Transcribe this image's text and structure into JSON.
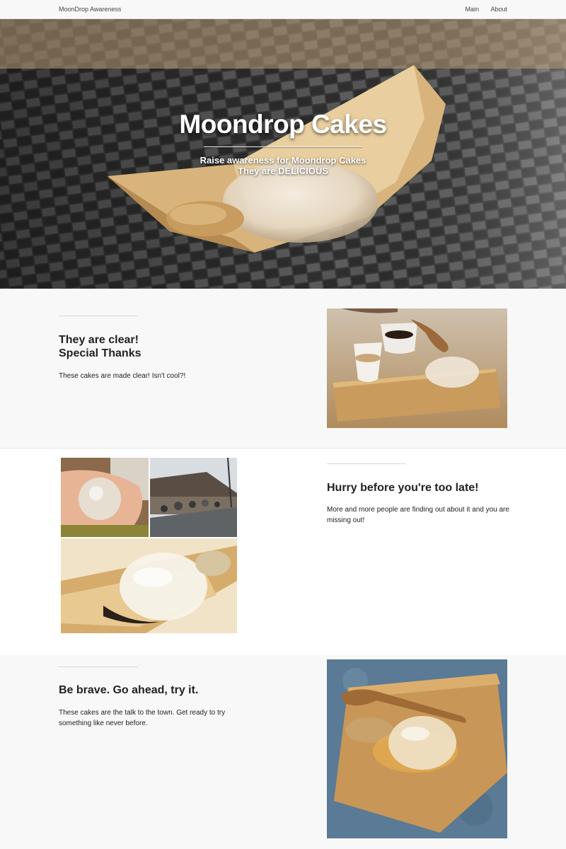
{
  "nav": {
    "brand": "MoonDrop Awareness",
    "links": [
      "Main",
      "About"
    ]
  },
  "hero": {
    "title": "Moondrop Cakes",
    "subtitle_line1": "Raise awareness for Moondrop Cakes",
    "subtitle_line2": "They are DELICIOUS"
  },
  "sections": [
    {
      "heading_line1": "They are clear!",
      "heading_line2": "Special Thanks",
      "text": "These cakes are made clear! Isn't cool?!"
    },
    {
      "heading_line1": "Hurry before you're too late!",
      "text": "More and more people are finding out about it and you are missing out!"
    },
    {
      "heading_line1": "Be brave. Go ahead, try it.",
      "text": "These cakes are the talk to the town. Get ready to try something like never before."
    }
  ],
  "colors": {
    "nav_bg": "#f8f8f8",
    "section_alt_bg": "#ffffff",
    "text": "#222222"
  }
}
